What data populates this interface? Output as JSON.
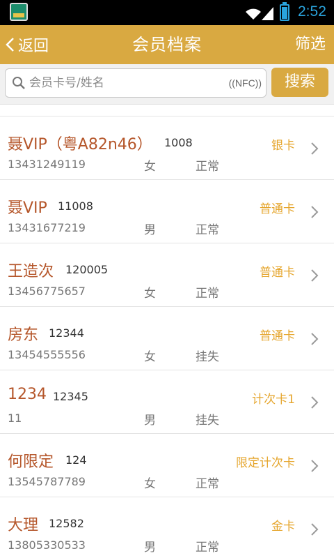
{
  "status_bar": {
    "time": "2:52"
  },
  "header": {
    "back_label": "返回",
    "title": "会员档案",
    "filter_label": "筛选"
  },
  "search": {
    "placeholder": "会员卡号/姓名",
    "value": "",
    "nfc_label": "((NFC))",
    "button_label": "搜索"
  },
  "members": [
    {
      "name": "聂VIP（粤A82n46）",
      "card_no": "1008",
      "phone": "13431249119",
      "gender": "女",
      "status": "正常",
      "card_type": "银卡"
    },
    {
      "name": "聂VIP",
      "card_no": "11008",
      "phone": "13431677219",
      "gender": "男",
      "status": "正常",
      "card_type": "普通卡"
    },
    {
      "name": "王造次",
      "card_no": "120005",
      "phone": "13456775657",
      "gender": "女",
      "status": "正常",
      "card_type": "普通卡"
    },
    {
      "name": "房东",
      "card_no": "12344",
      "phone": "13454555556",
      "gender": "女",
      "status": "挂失",
      "card_type": "普通卡"
    },
    {
      "name": "1234",
      "card_no": "12345",
      "phone": "11",
      "gender": "男",
      "status": "挂失",
      "card_type": "计次卡1"
    },
    {
      "name": "何限定",
      "card_no": "124",
      "phone": "13545787789",
      "gender": "女",
      "status": "正常",
      "card_type": "限定计次卡"
    },
    {
      "name": "大理",
      "card_no": "12582",
      "phone": "13805330533",
      "gender": "男",
      "status": "正常",
      "card_type": "金卡"
    }
  ],
  "colors": {
    "accent": "#d9a941",
    "name": "#b5562a",
    "card_type": "#e5a52c",
    "status_bar_icons": "#2aa3dc"
  },
  "icons": [
    "app-icon",
    "wifi-icon",
    "signal-icon",
    "battery-icon",
    "back-chevron-icon",
    "search-icon",
    "chevron-right-icon"
  ]
}
